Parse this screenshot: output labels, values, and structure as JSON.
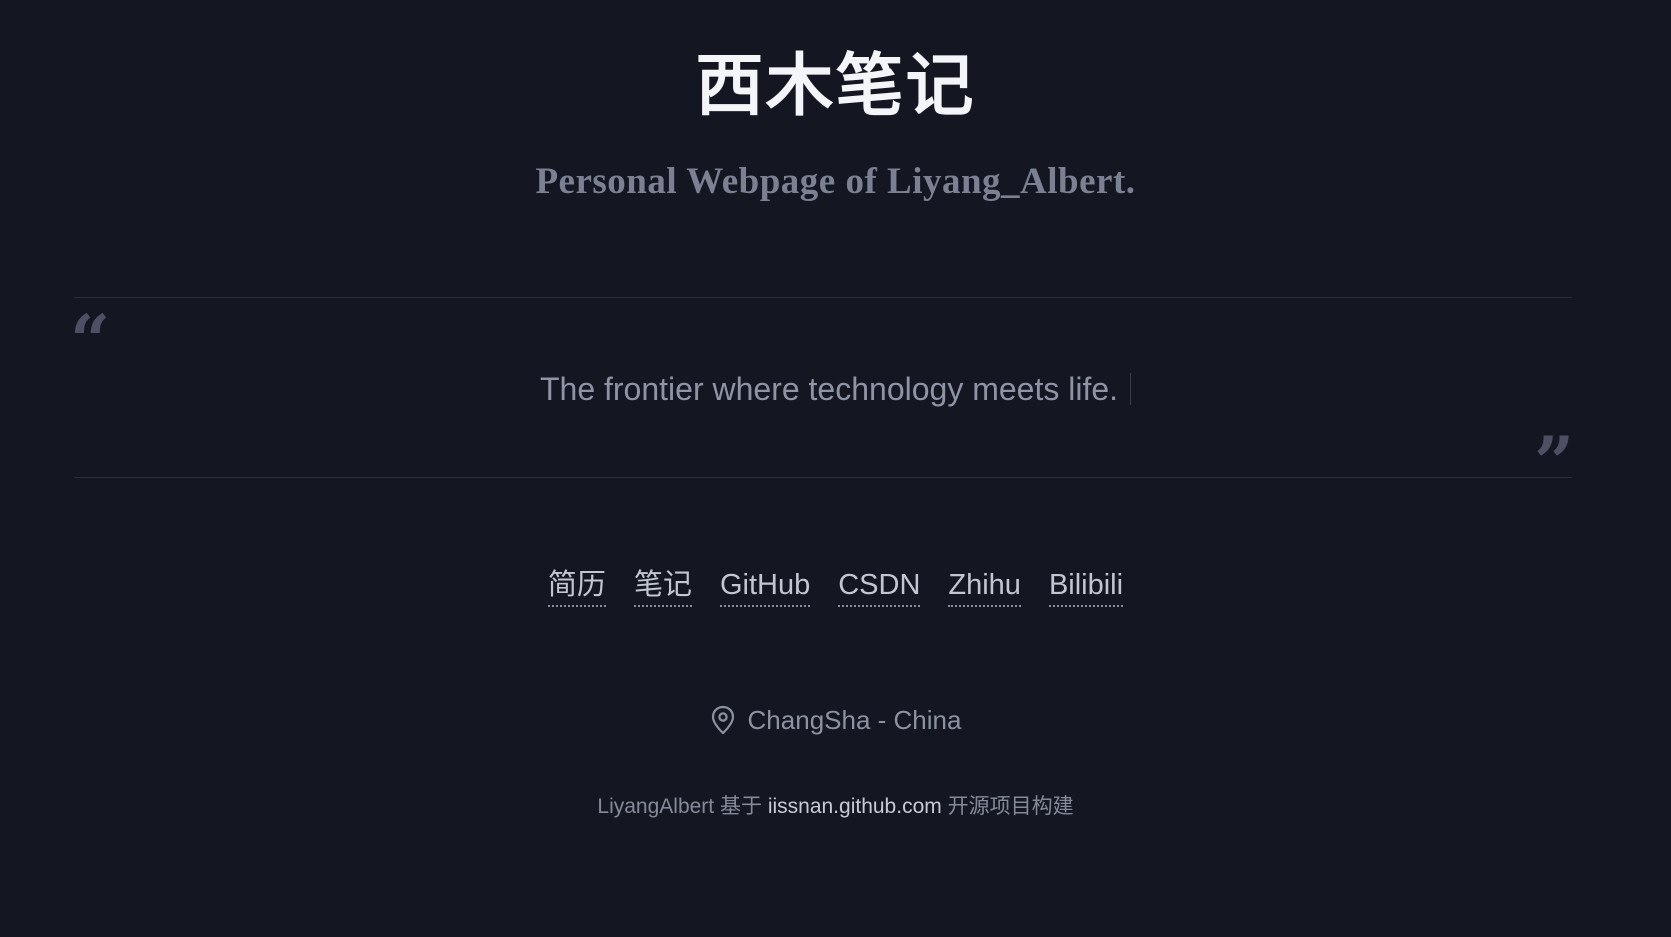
{
  "header": {
    "title": "西木笔记",
    "subtitle": "Personal Webpage of Liyang_Albert."
  },
  "quote": {
    "open_mark": "“",
    "text": "The frontier where technology meets life.",
    "close_mark": "”"
  },
  "nav": {
    "links": [
      {
        "label": "简历"
      },
      {
        "label": "笔记"
      },
      {
        "label": "GitHub"
      },
      {
        "label": "CSDN"
      },
      {
        "label": "Zhihu"
      },
      {
        "label": "Bilibili"
      }
    ]
  },
  "location": {
    "icon": "map-pin-icon",
    "text": "ChangSha - China"
  },
  "footer": {
    "author": "LiyangAlbert",
    "based_on": " 基于 ",
    "link_text": "iissnan.github.com",
    "suffix": " 开源项目构建"
  },
  "colors": {
    "background": "#141621",
    "title": "#f4f5f8",
    "muted": "#7b8093",
    "link": "#c2c6d3"
  }
}
